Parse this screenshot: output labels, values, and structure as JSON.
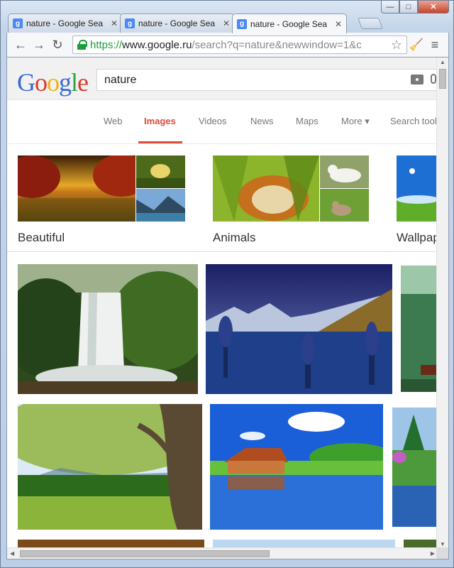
{
  "tabs": [
    {
      "title": "nature - Google Sea",
      "close": "✕",
      "favicon": "g"
    },
    {
      "title": "nature - Google Sea",
      "close": "✕",
      "favicon": "g"
    },
    {
      "title": "nature - Google Sea",
      "close": "✕",
      "favicon": "g"
    }
  ],
  "window_controls": {
    "minimize": "—",
    "maximize": "□",
    "close": "✕"
  },
  "toolbar": {
    "back": "←",
    "forward": "→",
    "reload": "↻",
    "url_scheme": "https://",
    "url_host": "www.google.ru",
    "url_path": "/search?q=nature&newwindow=1&c",
    "star": "☆",
    "extension": "🧹",
    "menu": "≡"
  },
  "search": {
    "query": "nature"
  },
  "nav": {
    "items": [
      "Web",
      "Images",
      "Videos",
      "News",
      "Maps",
      "More ▾",
      "Search tools"
    ],
    "active": "Images"
  },
  "categories": [
    "Beautiful",
    "Animals",
    "Wallpaper"
  ],
  "colors": {
    "accent": "#dd4b39",
    "link": "#3b6ad6"
  }
}
